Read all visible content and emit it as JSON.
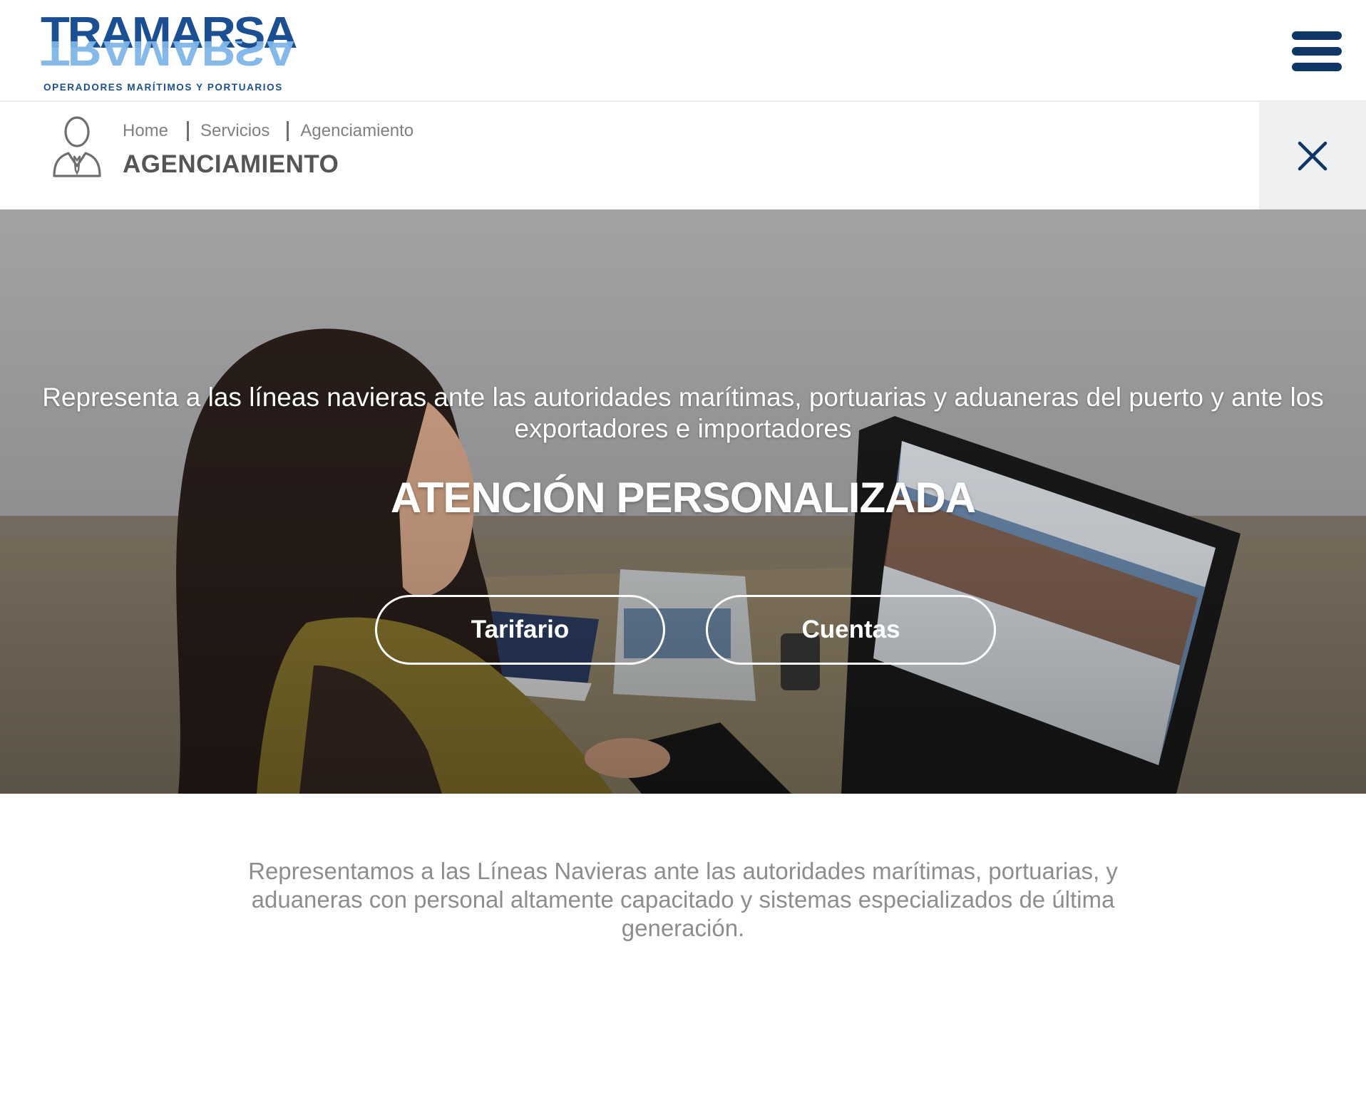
{
  "header": {
    "logo": {
      "wordmark": "TRAMARSA",
      "tagline": "OPERADORES MARÍTIMOS Y PORTUARIOS"
    },
    "menu_icon": "hamburger-menu-icon"
  },
  "breadcrumb": {
    "items": [
      "Home",
      "Servicios",
      "Agenciamiento"
    ]
  },
  "page": {
    "title": "AGENCIAMIENTO",
    "icon": "person-with-tie-icon",
    "close_icon": "close-icon"
  },
  "hero": {
    "subtitle": "Representa a las líneas navieras ante las autoridades marítimas, portuarias y aduaneras del puerto y ante los exportadores e importadores",
    "title": "ATENCIÓN PERSONALIZADA",
    "buttons": [
      "Tarifario",
      "Cuentas"
    ]
  },
  "description": "Representamos a las Líneas Navieras ante las autoridades marítimas, portuarias, y aduaneras con personal altamente capacitado y sistemas especializados de última generación.",
  "colors": {
    "brand_dark_blue": "#1a4f94",
    "brand_light_blue": "#7eb6e8",
    "menu_navy": "#0f3766",
    "title_gray": "#555555",
    "body_gray": "#8d8d8d",
    "close_bg": "#eef0f2"
  }
}
